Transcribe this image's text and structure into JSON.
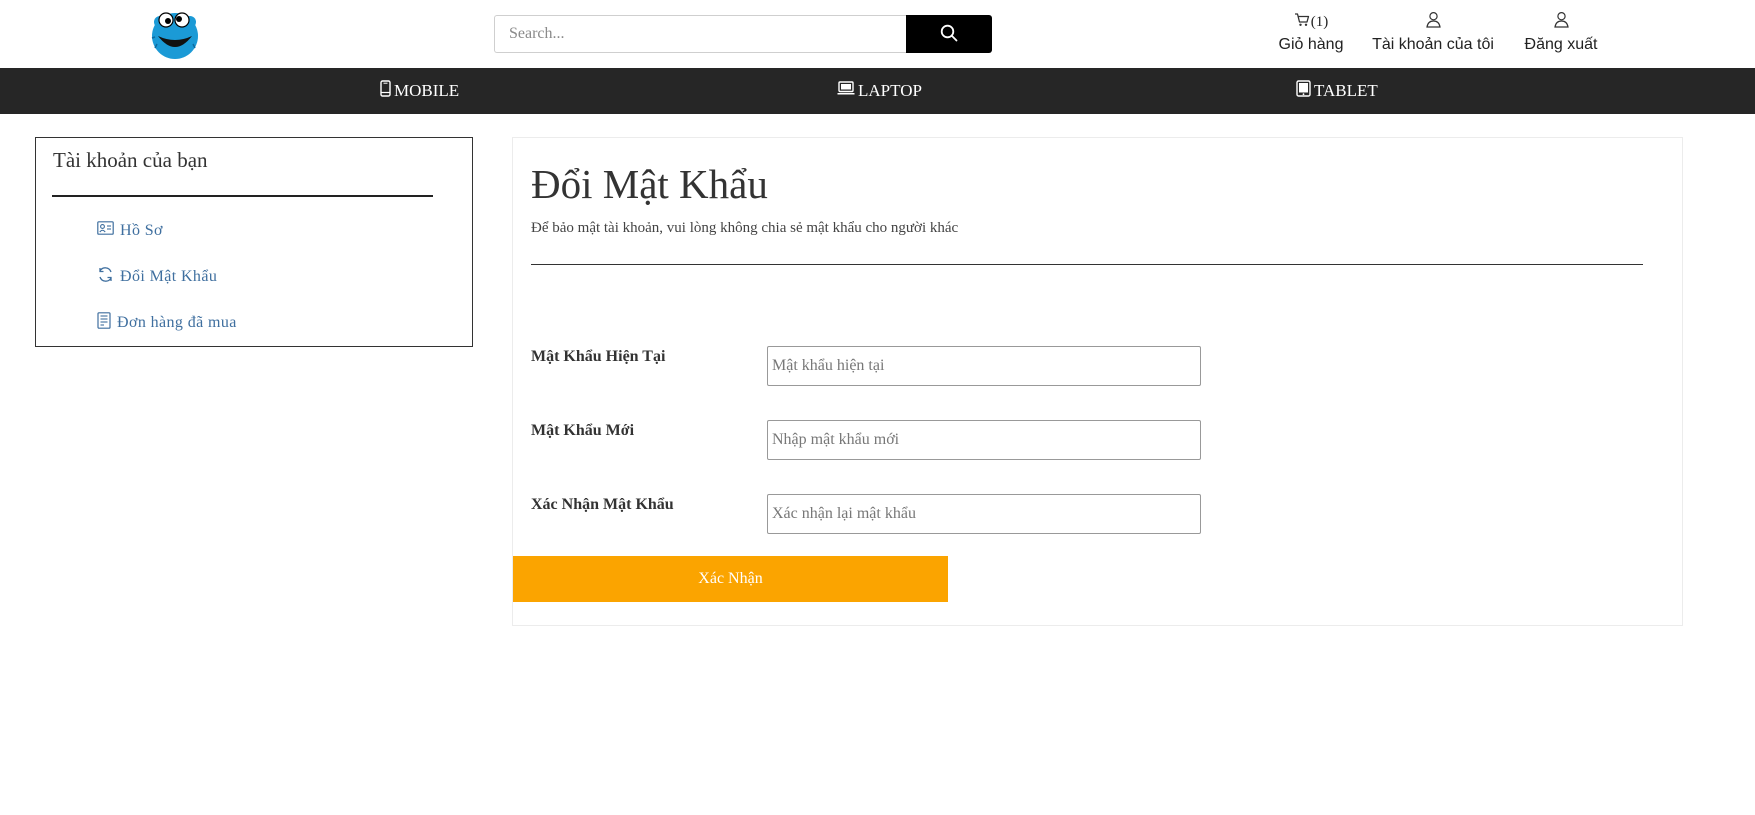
{
  "header": {
    "search_placeholder": "Search...",
    "cart": {
      "count": "(1)",
      "label": "Giỏ hàng"
    },
    "account_label": "Tài khoản của tôi",
    "logout_label": "Đăng xuất"
  },
  "nav": {
    "items": [
      {
        "label": "MOBILE",
        "icon": "mobile-phone-icon"
      },
      {
        "label": "LAPTOP",
        "icon": "laptop-icon"
      },
      {
        "label": "TABLET",
        "icon": "tablet-icon"
      }
    ]
  },
  "sidebar": {
    "title": "Tài khoản của bạn",
    "items": [
      {
        "label": "Hồ Sơ",
        "icon": "profile-card-icon"
      },
      {
        "label": "Đổi Mật Khẩu",
        "icon": "refresh-icon"
      },
      {
        "label": "Đơn hàng đã mua",
        "icon": "receipt-icon"
      }
    ]
  },
  "main": {
    "title": "Đổi Mật Khẩu",
    "subtitle": "Để bảo mật tài khoản, vui lòng không chia sẻ mật khẩu cho người khác",
    "fields": [
      {
        "label": "Mật Khẩu Hiện Tại",
        "placeholder": "Mật khẩu hiện tại",
        "value": ""
      },
      {
        "label": "Mật Khẩu Mới",
        "placeholder": "Nhập mật khẩu mới",
        "value": ""
      },
      {
        "label": "Xác Nhận Mật Khẩu",
        "placeholder": "Xác nhận lại mật khẩu",
        "value": ""
      }
    ],
    "submit_label": "Xác Nhận"
  },
  "colors": {
    "nav_background": "#262626",
    "submit_button": "#fba400",
    "sidebar_link": "#3f6f9f",
    "logo_blue": "#1b9ad6"
  }
}
